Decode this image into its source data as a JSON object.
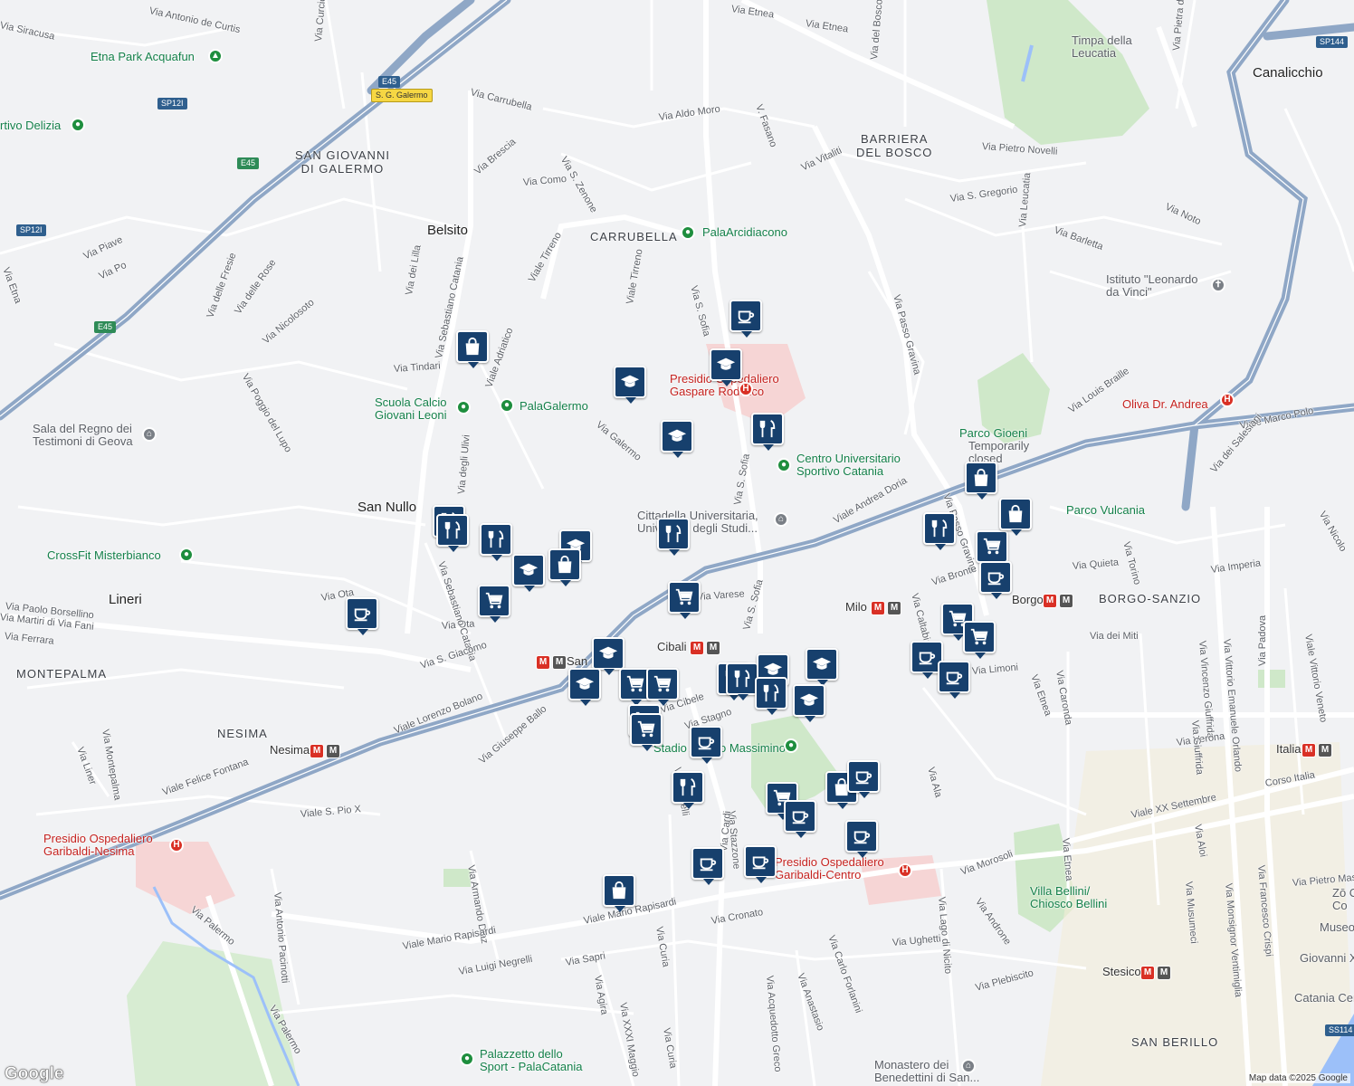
{
  "map": {
    "attribution": "Map data ©2025 Google",
    "logo": "Google",
    "colors": {
      "marker": "#17406d",
      "road": "#8fa7c6",
      "park": "#cfe8c9",
      "hospital": "#f6d5d5",
      "background": "#f1f2f4"
    },
    "markers": [
      {
        "type": "cafe",
        "icon": "cup-icon"
      },
      {
        "type": "school",
        "icon": "graduation-cap-icon"
      },
      {
        "type": "school",
        "icon": "graduation-cap-icon"
      },
      {
        "type": "restaurant",
        "icon": "fork-knife-icon"
      },
      {
        "type": "school",
        "icon": "graduation-cap-icon"
      },
      {
        "type": "shop",
        "icon": "shopping-bag-icon"
      },
      {
        "type": "restaurant",
        "icon": "fork-knife-icon"
      },
      {
        "type": "restaurant",
        "icon": "fork-knife-icon"
      },
      {
        "type": "restaurant",
        "icon": "fork-knife-icon"
      },
      {
        "type": "school",
        "icon": "graduation-cap-icon"
      },
      {
        "type": "shop",
        "icon": "shopping-bag-icon"
      },
      {
        "type": "school",
        "icon": "graduation-cap-icon"
      },
      {
        "type": "restaurant",
        "icon": "fork-knife-icon"
      },
      {
        "type": "grocery",
        "icon": "shopping-cart-icon"
      },
      {
        "type": "grocery",
        "icon": "shopping-cart-icon"
      },
      {
        "type": "cafe",
        "icon": "cup-icon"
      },
      {
        "type": "school",
        "icon": "graduation-cap-icon"
      },
      {
        "type": "school",
        "icon": "graduation-cap-icon"
      },
      {
        "type": "grocery",
        "icon": "shopping-cart-icon"
      },
      {
        "type": "grocery",
        "icon": "shopping-cart-icon"
      },
      {
        "type": "grocery",
        "icon": "shopping-cart-icon"
      },
      {
        "type": "grocery",
        "icon": "shopping-cart-icon"
      },
      {
        "type": "restaurant",
        "icon": "fork-knife-icon"
      },
      {
        "type": "restaurant",
        "icon": "fork-knife-icon"
      },
      {
        "type": "school",
        "icon": "graduation-cap-icon"
      },
      {
        "type": "school",
        "icon": "graduation-cap-icon"
      },
      {
        "type": "restaurant",
        "icon": "fork-knife-icon"
      },
      {
        "type": "school",
        "icon": "graduation-cap-icon"
      },
      {
        "type": "cafe",
        "icon": "cup-icon"
      },
      {
        "type": "restaurant",
        "icon": "fork-knife-icon"
      },
      {
        "type": "shop",
        "icon": "shopping-bag-icon"
      },
      {
        "type": "cafe",
        "icon": "cup-icon"
      },
      {
        "type": "grocery",
        "icon": "shopping-cart-icon"
      },
      {
        "type": "cafe",
        "icon": "cup-icon"
      },
      {
        "type": "cafe",
        "icon": "cup-icon"
      },
      {
        "type": "cafe",
        "icon": "cup-icon"
      },
      {
        "type": "cafe",
        "icon": "cup-icon"
      },
      {
        "type": "cafe",
        "icon": "cup-icon"
      },
      {
        "type": "shop",
        "icon": "shopping-bag-icon"
      },
      {
        "type": "shop",
        "icon": "shopping-bag-icon"
      },
      {
        "type": "restaurant",
        "icon": "fork-knife-icon"
      },
      {
        "type": "grocery",
        "icon": "shopping-cart-icon"
      },
      {
        "type": "shop",
        "icon": "shopping-bag-icon"
      },
      {
        "type": "grocery",
        "icon": "shopping-cart-icon"
      },
      {
        "type": "grocery",
        "icon": "shopping-cart-icon"
      },
      {
        "type": "cafe",
        "icon": "cup-icon"
      },
      {
        "type": "cafe",
        "icon": "cup-icon"
      }
    ],
    "areas": {
      "san_giovanni": "SAN GIOVANNI\nDI GALERMO",
      "carrubella": "CARRUBELLA",
      "barriera": "BARRIERA\nDEL BOSCO",
      "borgo_sanzio": "BORGO-SANZIO",
      "montepalma": "MONTEPALMA",
      "nesima": "NESIMA",
      "san_berillo": "SAN BERILLO"
    },
    "towns": {
      "belsito": "Belsito",
      "san_nullo": "San Nullo",
      "lineri": "Lineri",
      "canalicchio": "Canalicchio"
    },
    "pois": {
      "etna_park": "Etna Park Acquafun",
      "sportivo_delizia": "rtivo Delizia",
      "scuola_calcio": "Scuola Calcio\nGiovani Leoni",
      "palagalermo": "PalaGalermo",
      "palaarcidiacono": "PalaArcidiacono",
      "sala_regno": "Sala del Regno dei\nTestimoni di Geova",
      "crossfit": "CrossFit Misterbianco",
      "presidio_rodolico": "Presidio Ospedaliero\nGaspare Rodolico",
      "centro_universitario": "Centro Universitario\nSportivo Catania",
      "cittadella": "Cittadella Universitaria,\nUniversità degli Studi...",
      "timpa": "Timpa della\nLeucatia",
      "istituto": "Istituto \"Leonardo\nda Vinci\"",
      "oliva": "Oliva Dr. Andrea",
      "parco_gioeni": "Parco Gioeni",
      "temporarily_closed": "Temporarily\nclosed",
      "parco_vulcania": "Parco Vulcania",
      "milo": "Milo",
      "borgo": "Borgo",
      "cibali": "Cibali",
      "san_nullo_metro": "San",
      "nesima_metro": "Nesima",
      "italia": "Italia",
      "stesicoro": "Stesicoro",
      "stadio": "Stadio Angelo Massimino",
      "presidio_nesima": "Presidio Ospedaliero\nGaribaldi-Nesima",
      "presidio_centro": "Presidio Ospedaliero\nGaribaldi-Centro",
      "villa_bellini": "Villa Bellini/\nChiosco Bellini",
      "monastero": "Monastero dei\nBenedettini di San...",
      "palazzetto": "Palazzetto dello\nSport - PalaCatania",
      "museo": "Museo",
      "giovanni": "Giovanni X",
      "catania_cen": "Catania Cen",
      "zo": "Zō C\nCo"
    },
    "shields": {
      "e45_top": "E45",
      "sg_galermo": "S. G. Galermo",
      "sp12i_a": "SP12I",
      "e45_mid": "E45",
      "sp12i_b": "SP12I",
      "e45_low": "E45",
      "sp144": "SP144",
      "ss114": "SS114"
    },
    "streets": [
      "Via Siracusa",
      "Via Antonio de Curtis",
      "Via Curcio",
      "Via Etnea",
      "Via Etnea",
      "Via Carrubella",
      "Via Aldo Moro",
      "V. Fasano",
      "Via del Bosco",
      "Via Pietra dell'Ova",
      "Via Pietro Novelli",
      "Via Vitaliti",
      "Via Brescia",
      "Via Como",
      "Via S. Zenone",
      "Via S. Gregorio",
      "Via Leucatia",
      "Via Noto",
      "Via Barletta",
      "Via Piave",
      "Via Po",
      "Via Etna",
      "Via delle Fresie",
      "Via delle Rose",
      "Via Nicolosoto",
      "Via dei Lilla",
      "Via Sebastiano Catania",
      "Viale Tirreno",
      "Viale Tirreno",
      "Via S. Sofia",
      "Via Passo Gravina",
      "Via Tindari",
      "Viale Adriatico",
      "Via Poggio del Lupo",
      "Via Galermo",
      "Via Louis Braille",
      "Viale Marco Polo",
      "Via dei Salesiani",
      "Viale Andrea Doria",
      "Via S. Sofia",
      "Via Passo Gravina",
      "Via Torino",
      "Via Nicolo",
      "Via Quieta",
      "Via Imperia",
      "Via Bronte",
      "Via Caltabiano",
      "Via degli Ulivi",
      "Via Ota",
      "Via Ota",
      "Via Paolo Borsellino",
      "Via Martiri di Via Fani",
      "Via Ferrara",
      "Via Sebastiano Catania",
      "Via S. Giacomo",
      "Via Varese",
      "Via S. Sofia",
      "Via dei Miti",
      "Via Padova",
      "Viale Vittorio Veneto",
      "Via Vincenzo Giuffrida",
      "Via Vittorio Emanuele Orlando",
      "Via Cibele",
      "Via Stagno",
      "Via Giuseppe Ballo",
      "Viale Lorenzo Bolano",
      "Via Liner",
      "Via Montepalma",
      "Via Limoni",
      "Via Etnea",
      "Via Caronda",
      "Via Verona",
      "Via Monsignor Ventimiglia",
      "Via Francesco Crispi",
      "Corso Italia",
      "Viale XX Settembre",
      "Via Aloi",
      "Viale Felice Fontana",
      "Viale S. Pio X",
      "Via Ala",
      "Via Martelli",
      "Via Stazzone",
      "Via Cardi",
      "Via Morosoli",
      "Via Androne",
      "Via Pietro Mascagni",
      "Via Armando Diaz",
      "Via Antonio Pacinotti",
      "Via Palermo",
      "Viale Mario Rapisardi",
      "Viale Mario Rapisardi",
      "Via Luigi Negrelli",
      "Via Sapri",
      "Via Cronato",
      "Via Curia",
      "Via Carlo Forlanini",
      "Via Ughetti",
      "Via Lago di Nicito",
      "Via Plebiscito",
      "Via Musumeci",
      "Via Acquedotto Greco",
      "Via Anastasio",
      "Via Agira",
      "Via XXXI Maggio",
      "Via Curia",
      "Via Palermo",
      "Via Etnea",
      "Via Giuffrida"
    ]
  }
}
